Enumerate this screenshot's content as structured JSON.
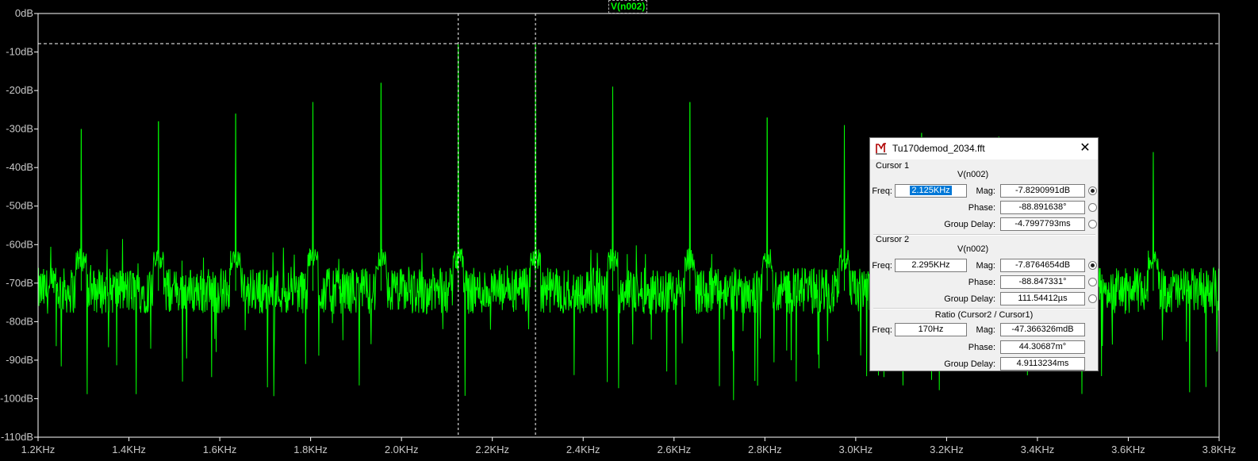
{
  "trace_label": "V(n002)",
  "colors": {
    "trace": "#00ff00",
    "background": "#000000",
    "axis": "#ffffff",
    "tick_text": "#c8c8c8",
    "dialog_bg": "#f0f0f0",
    "selection": "#0078d7"
  },
  "chart_data": {
    "type": "line",
    "title": "",
    "xlabel": "",
    "ylabel": "",
    "xlim": [
      1200,
      3800
    ],
    "ylim": [
      -110,
      0
    ],
    "x_ticks": [
      1200,
      1400,
      1600,
      1800,
      2000,
      2200,
      2400,
      2600,
      2800,
      3000,
      3200,
      3400,
      3600,
      3800
    ],
    "x_tick_labels": [
      "1.2KHz",
      "1.4KHz",
      "1.6KHz",
      "1.8KHz",
      "2.0KHz",
      "2.2KHz",
      "2.4KHz",
      "2.6KHz",
      "2.8KHz",
      "3.0KHz",
      "3.2KHz",
      "3.4KHz",
      "3.6KHz",
      "3.8KHz"
    ],
    "y_ticks": [
      0,
      -10,
      -20,
      -30,
      -40,
      -50,
      -60,
      -70,
      -80,
      -90,
      -100,
      -110
    ],
    "y_tick_labels": [
      "0dB",
      "-10dB",
      "-20dB",
      "-30dB",
      "-40dB",
      "-50dB",
      "-60dB",
      "-70dB",
      "-80dB",
      "-90dB",
      "-100dB",
      "-110dB"
    ],
    "series": [
      {
        "color": "#00ff00",
        "noise_floor_db": -72,
        "peaks": [
          {
            "freq": 1295,
            "mag": -30
          },
          {
            "freq": 1465,
            "mag": -28
          },
          {
            "freq": 1635,
            "mag": -26
          },
          {
            "freq": 1805,
            "mag": -23
          },
          {
            "freq": 1955,
            "mag": -18
          },
          {
            "freq": 2125,
            "mag": -8
          },
          {
            "freq": 2295,
            "mag": -8
          },
          {
            "freq": 2465,
            "mag": -19
          },
          {
            "freq": 2635,
            "mag": -23
          },
          {
            "freq": 2805,
            "mag": -27
          },
          {
            "freq": 2975,
            "mag": -29
          },
          {
            "freq": 3145,
            "mag": -31
          },
          {
            "freq": 3315,
            "mag": -32
          },
          {
            "freq": 3485,
            "mag": -34
          },
          {
            "freq": 3655,
            "mag": -36
          }
        ]
      }
    ],
    "cursor1_freq": 2125,
    "cursor2_freq": 2295,
    "horizontal_cursor_db": -7.83,
    "grid": false
  },
  "dialog": {
    "title": "Tu170demod_2034.fft",
    "close_glyph": "✕",
    "cursor1": {
      "heading": "Cursor 1",
      "trace": "V(n002)",
      "freq_label": "Freq:",
      "freq_value": "2.125KHz",
      "mag_label": "Mag:",
      "mag_value": "-7.8290991dB",
      "phase_label": "Phase:",
      "phase_value": "-88.891638°",
      "gd_label": "Group Delay:",
      "gd_value": "-4.7997793ms"
    },
    "cursor2": {
      "heading": "Cursor 2",
      "trace": "V(n002)",
      "freq_label": "Freq:",
      "freq_value": "2.295KHz",
      "mag_label": "Mag:",
      "mag_value": "-7.8764654dB",
      "phase_label": "Phase:",
      "phase_value": "-88.847331°",
      "gd_label": "Group Delay:",
      "gd_value": "111.54412µs"
    },
    "ratio": {
      "heading": "Ratio (Cursor2 / Cursor1)",
      "freq_label": "Freq:",
      "freq_value": "170Hz",
      "mag_label": "Mag:",
      "mag_value": "-47.366326mdB",
      "phase_label": "Phase:",
      "phase_value": "44.30687m°",
      "gd_label": "Group Delay:",
      "gd_value": "4.9113234ms"
    }
  }
}
